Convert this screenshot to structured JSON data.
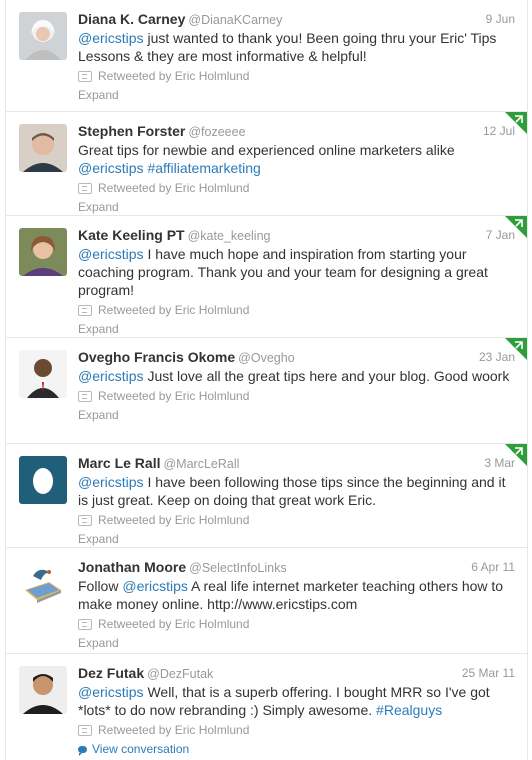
{
  "tweets": [
    {
      "name": "Diana K. Carney",
      "handle": "@DianaKCarney",
      "time": "9 Jun",
      "text": [
        {
          "t": "@ericstips",
          "link": true
        },
        {
          "t": " just wanted to thank you! Been going thru your Eric' Tips Lessons & they are most informative & helpful!",
          "link": false
        }
      ],
      "retweeted_by": "Retweeted by Eric Holmlund",
      "action": "Expand",
      "favorited": false
    },
    {
      "name": "Stephen Forster",
      "handle": "@fozeeee",
      "time": "12 Jul",
      "text": [
        {
          "t": "Great tips for newbie and experienced online marketers alike ",
          "link": false
        },
        {
          "t": "@ericstips",
          "link": true
        },
        {
          "t": " ",
          "link": false
        },
        {
          "t": "#affiliatemarketing",
          "link": true
        }
      ],
      "retweeted_by": "Retweeted by Eric Holmlund",
      "action": "Expand",
      "favorited": true
    },
    {
      "name": "Kate Keeling PT",
      "handle": "@kate_keeling",
      "time": "7 Jan",
      "text": [
        {
          "t": "@ericstips",
          "link": true
        },
        {
          "t": " I have much hope and inspiration from starting your coaching program. Thank you and your team for designing a great program!",
          "link": false
        }
      ],
      "retweeted_by": "Retweeted by Eric Holmlund",
      "action": "Expand",
      "favorited": true
    },
    {
      "name": "Ovegho Francis Okome",
      "handle": "@Ovegho",
      "time": "23 Jan",
      "text": [
        {
          "t": "@ericstips",
          "link": true
        },
        {
          "t": " Just love all the great tips here and your blog. Good woork",
          "link": false
        }
      ],
      "retweeted_by": "Retweeted by Eric Holmlund",
      "action": "Expand",
      "favorited": true
    },
    {
      "name": "Marc Le Rall",
      "handle": "@MarcLeRall",
      "time": "3 Mar",
      "text": [
        {
          "t": "@ericstips",
          "link": true
        },
        {
          "t": " I have been following those tips since the beginning and it is just great. Keep on doing that great work Eric.",
          "link": false
        }
      ],
      "retweeted_by": "Retweeted by Eric Holmlund",
      "action": "Expand",
      "favorited": true
    },
    {
      "name": "Jonathan Moore",
      "handle": "@SelectInfoLinks",
      "time": "6 Apr 11",
      "text": [
        {
          "t": "Follow ",
          "link": false
        },
        {
          "t": "@ericstips",
          "link": true
        },
        {
          "t": " A real life internet marketer teaching others how to make money online. http://www.ericstips.com",
          "link": false
        }
      ],
      "retweeted_by": "Retweeted by Eric Holmlund",
      "action": "Expand",
      "favorited": false
    },
    {
      "name": "Dez Futak",
      "handle": "@DezFutak",
      "time": "25 Mar 11",
      "text": [
        {
          "t": "@ericstips",
          "link": true
        },
        {
          "t": " Well, that is a superb offering. I bought MRR so I've got *lots* to do now rebranding :) Simply awesome. ",
          "link": false
        },
        {
          "t": "#Realguys",
          "link": true
        }
      ],
      "retweeted_by": "Retweeted by Eric Holmlund",
      "action": "View conversation",
      "favorited": false
    }
  ],
  "colors": {
    "link": "#2b7bb9",
    "meta": "#999999",
    "text": "#333333",
    "favorite_corner": "#2e9e3a"
  }
}
